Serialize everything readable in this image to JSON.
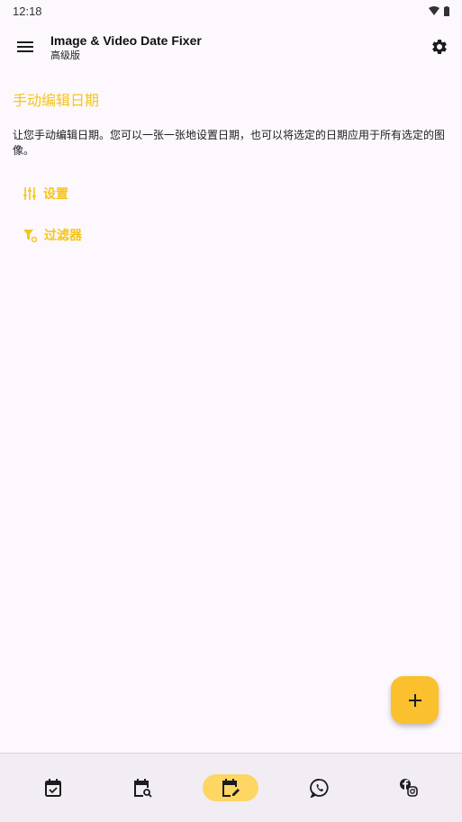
{
  "status": {
    "time": "12:18"
  },
  "app": {
    "title": "Image & Video Date Fixer",
    "subtitle": "高级版"
  },
  "section": {
    "title": "手动编辑日期",
    "description": "让您手动编辑日期。您可以一张一张地设置日期，也可以将选定的日期应用于所有选定的图像。"
  },
  "links": {
    "settings": "设置",
    "filter": "过滤器"
  },
  "fab": {
    "icon": "plus-icon"
  },
  "nav": {
    "items": [
      {
        "icon": "calendar-check-icon",
        "active": false
      },
      {
        "icon": "calendar-search-icon",
        "active": false
      },
      {
        "icon": "calendar-edit-icon",
        "active": true
      },
      {
        "icon": "whatsapp-icon",
        "active": false
      },
      {
        "icon": "facebook-instagram-icon",
        "active": false
      }
    ]
  },
  "colors": {
    "accent": "#f5c518",
    "fab": "#fbc02d",
    "nav_active": "#fdd663",
    "background": "#fdf8fd"
  }
}
